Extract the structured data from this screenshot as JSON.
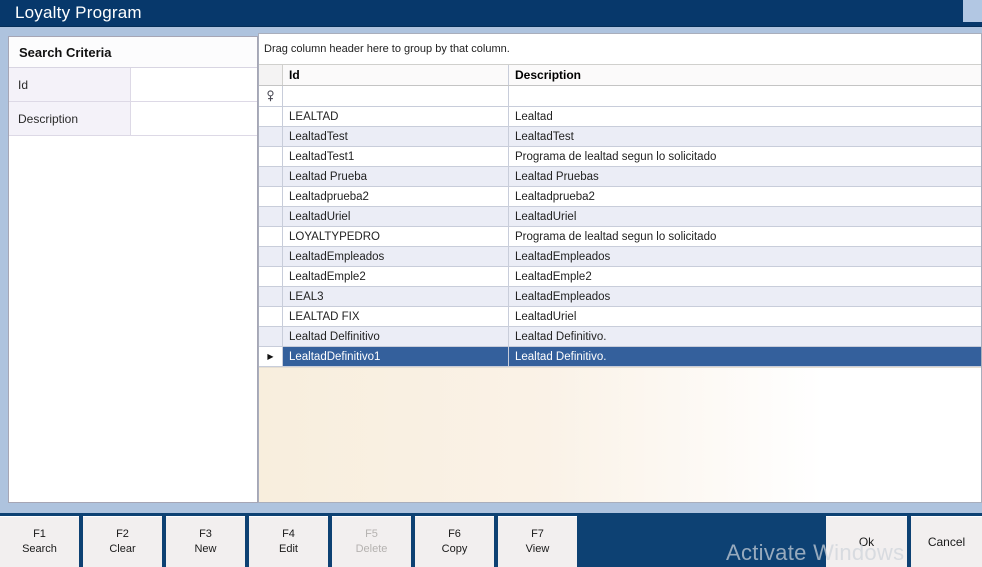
{
  "window": {
    "title": "Loyalty Program"
  },
  "search_panel": {
    "title": "Search Criteria",
    "fields": [
      {
        "label": "Id",
        "value": ""
      },
      {
        "label": "Description",
        "value": ""
      }
    ]
  },
  "grid": {
    "group_hint": "Drag column header here to group by that column.",
    "columns": [
      "Id",
      "Description"
    ],
    "filter_row_icon": "filter-pin-icon",
    "rows": [
      {
        "id": "LEALTAD",
        "description": "Lealtad"
      },
      {
        "id": "LealtadTest",
        "description": "LealtadTest"
      },
      {
        "id": "LealtadTest1",
        "description": "Programa de lealtad segun lo solicitado"
      },
      {
        "id": "Lealtad Prueba",
        "description": "Lealtad Pruebas"
      },
      {
        "id": "Lealtadprueba2",
        "description": "Lealtadprueba2"
      },
      {
        "id": "LealtadUriel",
        "description": "LealtadUriel"
      },
      {
        "id": "LOYALTYPEDRO",
        "description": "Programa de lealtad segun lo solicitado"
      },
      {
        "id": "LealtadEmpleados",
        "description": "LealtadEmpleados"
      },
      {
        "id": "LealtadEmple2",
        "description": "LealtadEmple2"
      },
      {
        "id": "LEAL3",
        "description": "LealtadEmpleados"
      },
      {
        "id": "LEALTAD FIX",
        "description": "LealtadUriel"
      },
      {
        "id": "Lealtad Delfinitivo",
        "description": "Lealtad Definitivo."
      },
      {
        "id": "LealtadDefinitivo1",
        "description": "Lealtad Definitivo."
      }
    ],
    "selected_row_index": 12
  },
  "toolbar": {
    "buttons": [
      {
        "key": "F1",
        "label": "Search",
        "enabled": true
      },
      {
        "key": "F2",
        "label": "Clear",
        "enabled": true
      },
      {
        "key": "F3",
        "label": "New",
        "enabled": true
      },
      {
        "key": "F4",
        "label": "Edit",
        "enabled": true
      },
      {
        "key": "F5",
        "label": "Delete",
        "enabled": false
      },
      {
        "key": "F6",
        "label": "Copy",
        "enabled": true
      },
      {
        "key": "F7",
        "label": "View",
        "enabled": true
      }
    ]
  },
  "dialog": {
    "ok_label": "Ok",
    "cancel_label": "Cancel"
  },
  "watermark": {
    "text": "Activate Windows"
  },
  "colors": {
    "title_bar": "#07386b",
    "window_bg": "#aec3de",
    "selection": "#34609c",
    "alt_row": "#ebedf6",
    "grid_line": "#c8cdda",
    "empty_area": "#f8eedd",
    "bar_navy": "#0d4173",
    "button_bg": "#f2efef"
  }
}
